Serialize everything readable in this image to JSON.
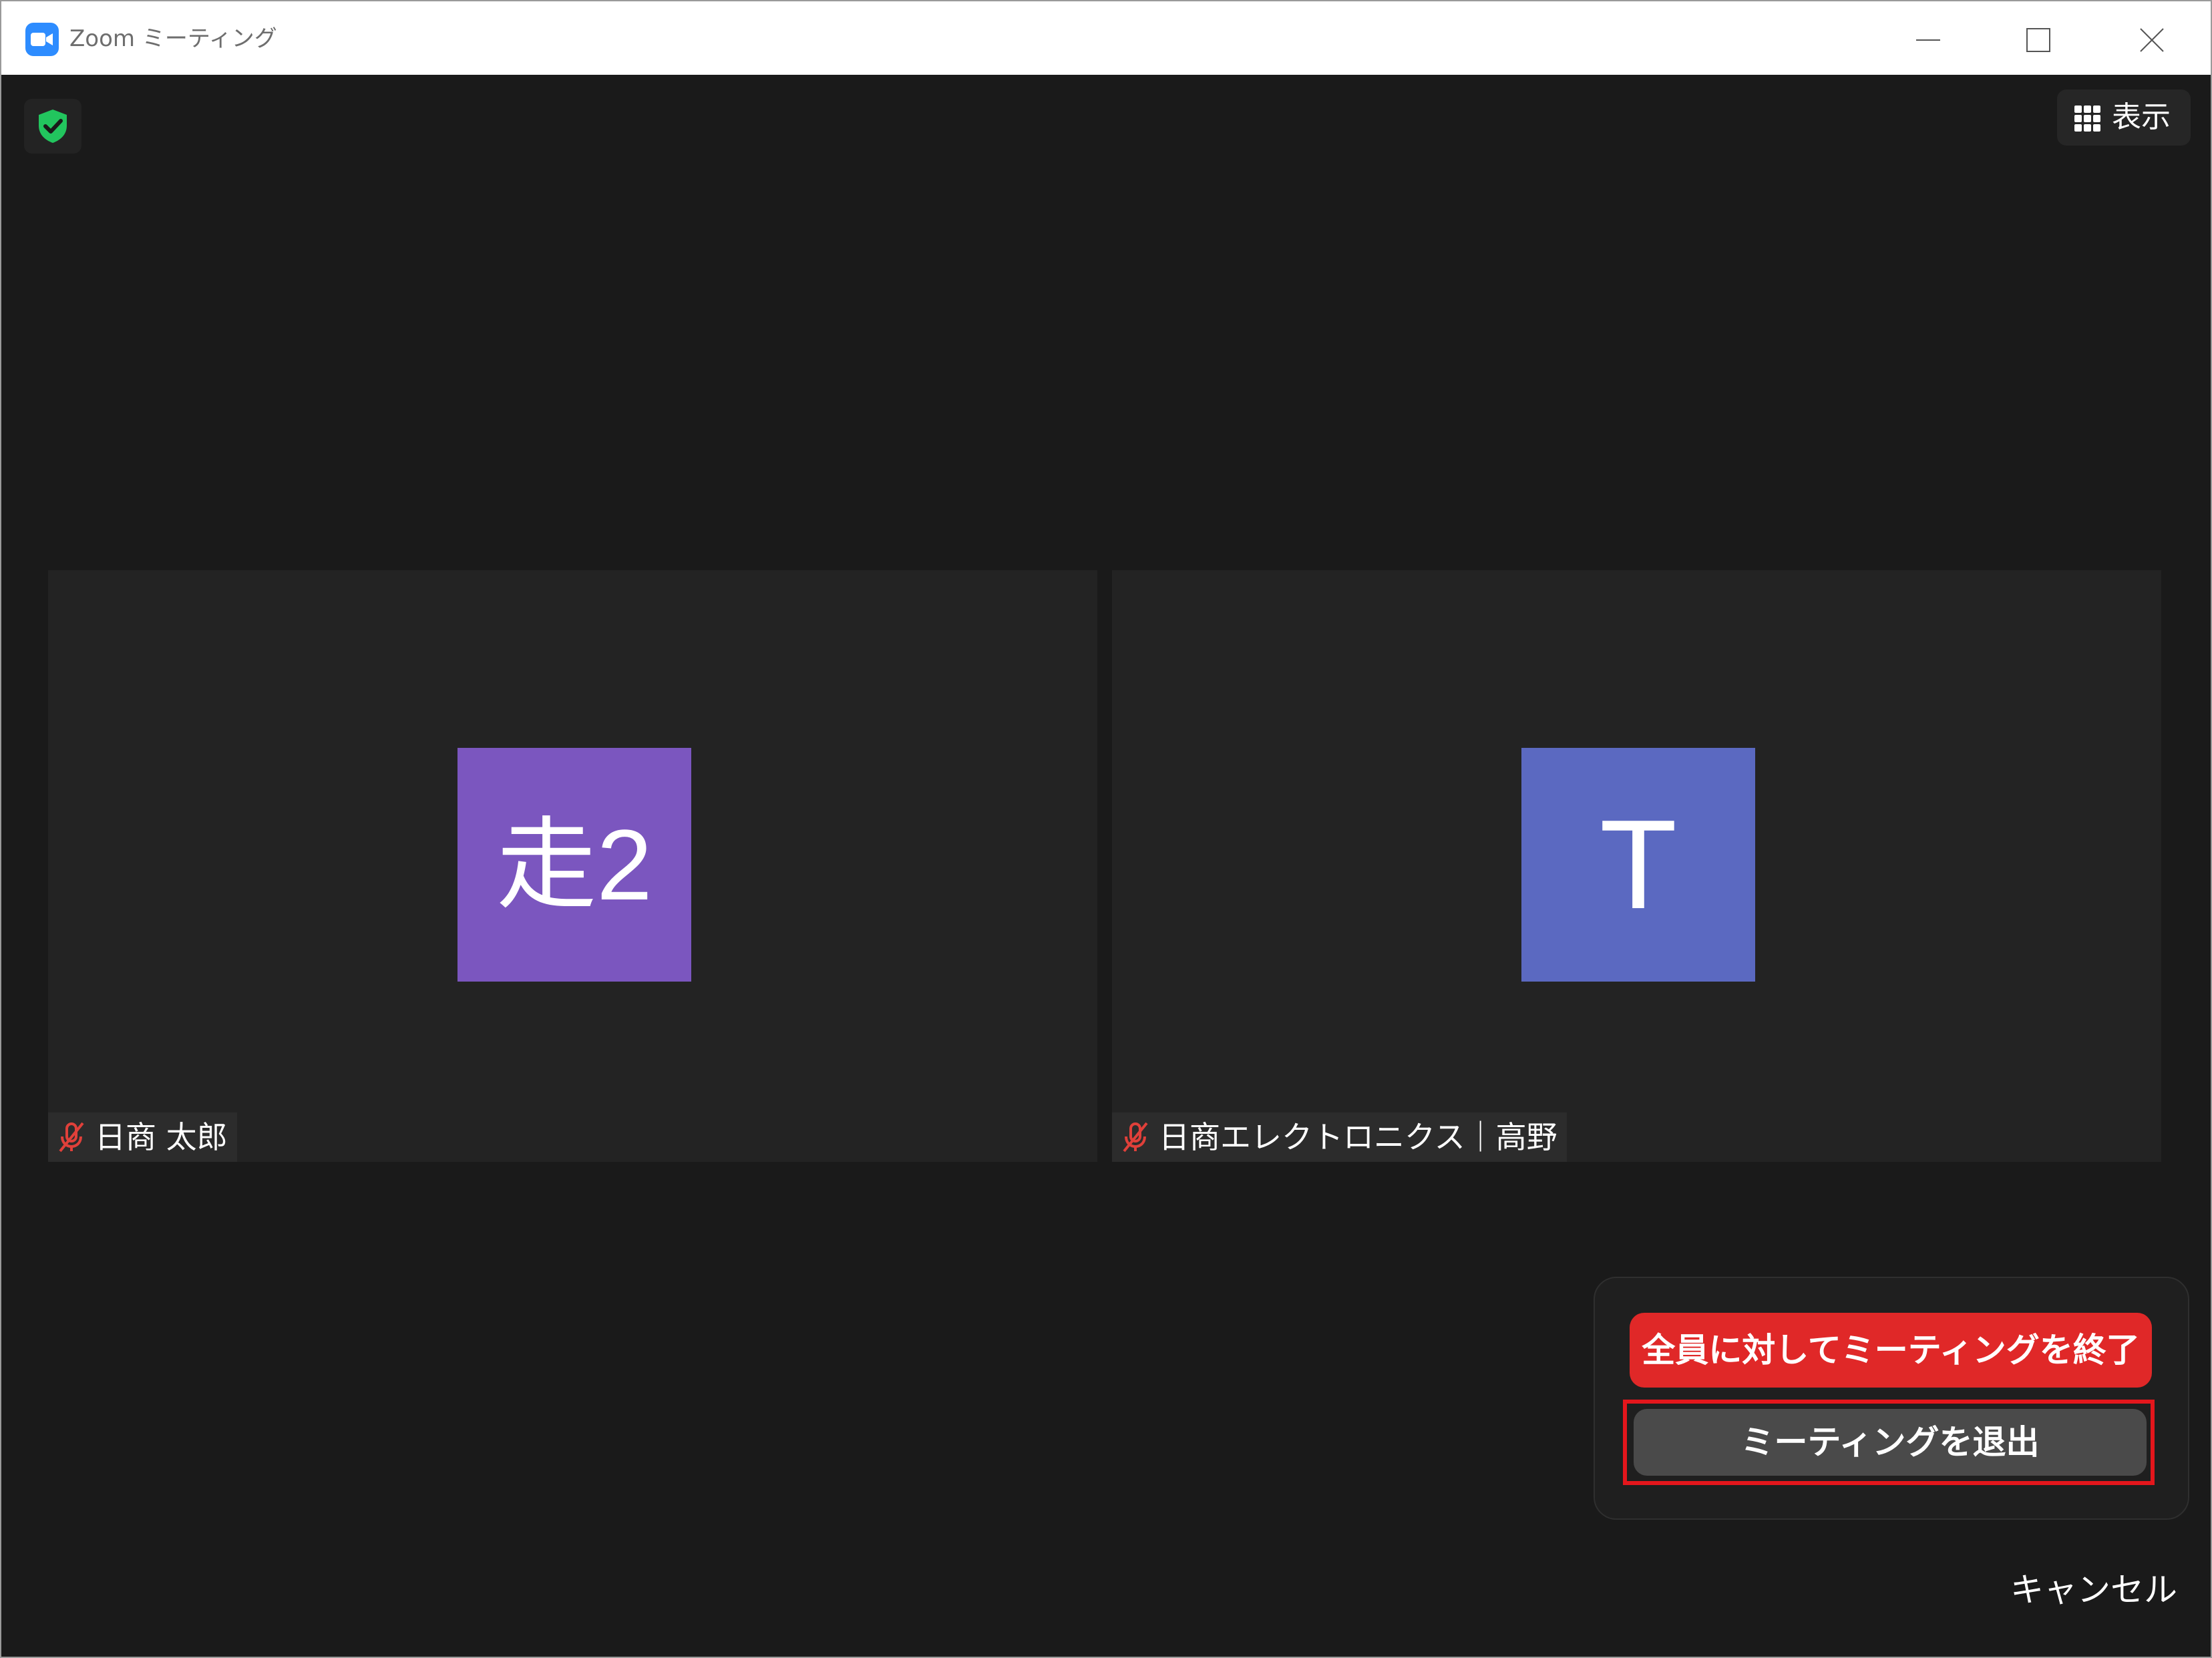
{
  "window": {
    "title": "Zoom ミーティング"
  },
  "toolbar": {
    "view_label": "表示"
  },
  "participants": [
    {
      "avatar_text": "走2",
      "name": "日商 太郎",
      "avatar_color": "#7b56bf",
      "muted": true
    },
    {
      "avatar_text": "T",
      "name": "日商エレクトロニクス｜高野",
      "avatar_color": "#5b69c1",
      "muted": true
    }
  ],
  "end_dialog": {
    "end_for_all_label": "全員に対してミーティングを終了",
    "leave_label": "ミーティングを退出",
    "cancel_label": "キャンセル"
  },
  "colors": {
    "accent_blue": "#2d8cff",
    "danger_red": "#e02828",
    "security_green": "#22c55e"
  }
}
